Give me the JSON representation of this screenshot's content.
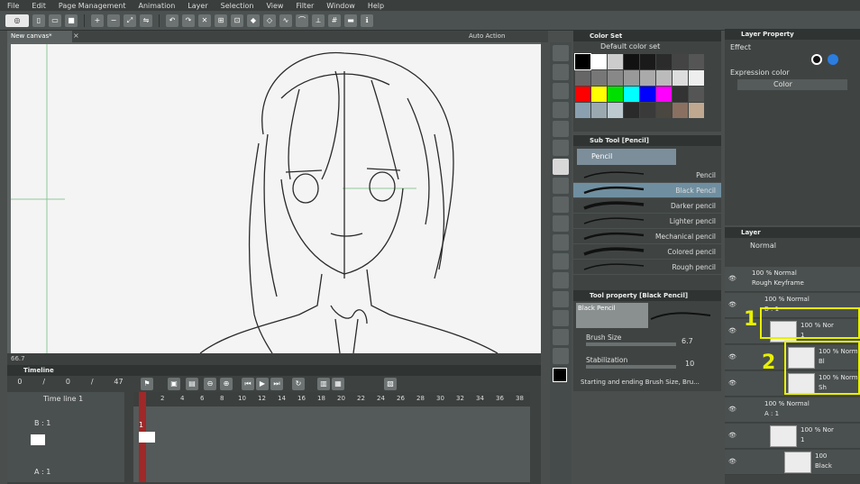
{
  "menu": [
    "File",
    "Edit",
    "Page Management",
    "Animation",
    "Layer",
    "Selection",
    "View",
    "Filter",
    "Window",
    "Help"
  ],
  "canvas_tab": "New canvas*",
  "auto_action_title": "Auto Action",
  "canvas_status": {
    "zoom": "66.7"
  },
  "timeline": {
    "title": "Timeline",
    "counter": [
      "0",
      "/",
      "0",
      "/",
      "47"
    ],
    "timeline_name": "Time line 1",
    "frame_numbers": [
      "1",
      "2",
      "4",
      "6",
      "8",
      "10",
      "12",
      "14",
      "16",
      "18",
      "20",
      "22",
      "24",
      "26",
      "28",
      "30",
      "32",
      "34",
      "36",
      "38"
    ],
    "tracks": [
      "B : 1",
      "A : 1"
    ],
    "cel_label": "1"
  },
  "color_set": {
    "title": "Color Set",
    "set_name": "Default color set",
    "colors": [
      "#000000",
      "#ffffff",
      "#cccccc",
      "#111111",
      "#1a1a1a",
      "#2b2b2b",
      "#444444",
      "#555555",
      "#666666",
      "#777777",
      "#888888",
      "#999999",
      "#aaaaaa",
      "#bbbbbb",
      "#dddddd",
      "#eeeeee",
      "#ff0000",
      "#ffff00",
      "#00e000",
      "#00ffff",
      "#0000ff",
      "#ff00ff",
      "#333333",
      "#555555",
      "#8aa0b0",
      "#9aa8b0",
      "#bccad0",
      "#2a2a2a",
      "#3a3a3a",
      "#4a4640",
      "#8a7060",
      "#c0a890"
    ]
  },
  "sub_tool": {
    "title": "Sub Tool [Pencil]",
    "group": "Pencil",
    "brushes": [
      "Pencil",
      "Black Pencil",
      "Darker pencil",
      "Lighter pencil",
      "Mechanical pencil",
      "Colored pencil",
      "Rough pencil"
    ],
    "selected_index": 1
  },
  "tool_property": {
    "title": "Tool property [Black Pencil]",
    "brush_name": "Black Pencil",
    "brush_size_label": "Brush Size",
    "brush_size_value": "6.7",
    "stabilization_label": "Stabilization",
    "stabilization_value": "10",
    "starting_ending": "Starting and ending Brush Size, Bru..."
  },
  "layer_property": {
    "title": "Layer Property",
    "effect_label": "Effect",
    "expression_color_label": "Expression color",
    "expression_color_value": "Color"
  },
  "layer": {
    "title": "Layer",
    "blend_mode": "Normal",
    "rows": [
      {
        "line1": "100 % Normal",
        "line2": "Rough Keyframe"
      },
      {
        "line1": "100 % Normal",
        "line2": "B : 1"
      },
      {
        "line1": "100 % Nor",
        "line2": "1"
      },
      {
        "line1": "100 % Norm",
        "line2": "Bl"
      },
      {
        "line1": "100 % Norm",
        "line2": "Sh"
      },
      {
        "line1": "100 % Normal",
        "line2": "A : 1"
      },
      {
        "line1": "100 % Nor",
        "line2": "1"
      },
      {
        "line1": "100",
        "line2": "Black"
      }
    ]
  },
  "annotations": [
    "1",
    "2"
  ]
}
